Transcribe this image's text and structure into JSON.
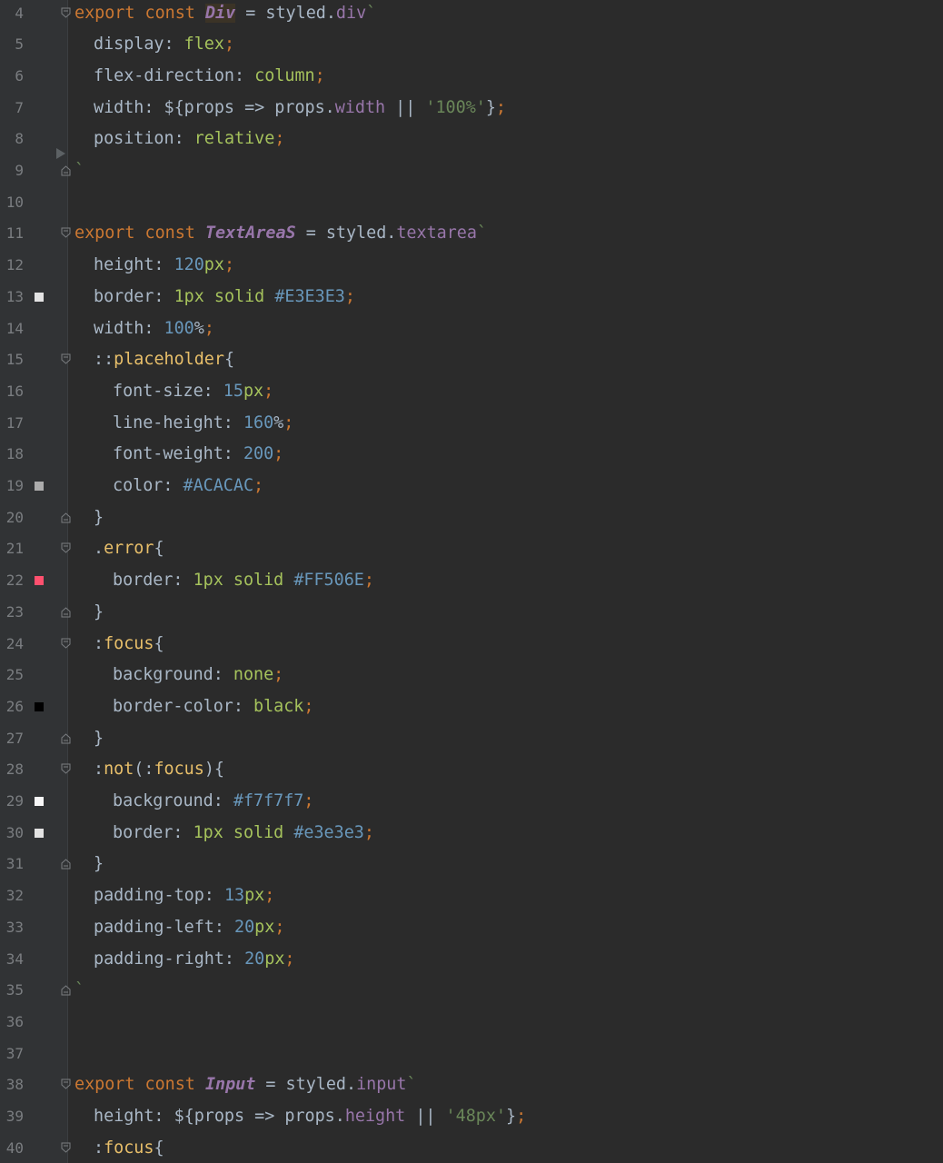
{
  "editor": {
    "language": "javascript",
    "lines": [
      {
        "num": "4",
        "fold": "open",
        "tokens": [
          {
            "t": "export",
            "c": "kw"
          },
          {
            "t": " ",
            "c": "plain"
          },
          {
            "t": "const",
            "c": "kw"
          },
          {
            "t": " ",
            "c": "plain"
          },
          {
            "t": "Div",
            "c": "name",
            "hl": true
          },
          {
            "t": " = styled.",
            "c": "plain"
          },
          {
            "t": "div",
            "c": "tag"
          },
          {
            "t": "`",
            "c": "str"
          }
        ]
      },
      {
        "num": "5",
        "indent": 1,
        "tokens": [
          {
            "t": "display: ",
            "c": "prop"
          },
          {
            "t": "flex",
            "c": "val"
          },
          {
            "t": ";",
            "c": "punct"
          }
        ]
      },
      {
        "num": "6",
        "indent": 1,
        "tokens": [
          {
            "t": "flex-direction: ",
            "c": "prop"
          },
          {
            "t": "column",
            "c": "val"
          },
          {
            "t": ";",
            "c": "punct"
          }
        ]
      },
      {
        "num": "7",
        "indent": 1,
        "tokens": [
          {
            "t": "width: ${props => props.",
            "c": "plain"
          },
          {
            "t": "width",
            "c": "tag"
          },
          {
            "t": " || ",
            "c": "plain"
          },
          {
            "t": "'100%'",
            "c": "str"
          },
          {
            "t": "}",
            "c": "plain"
          },
          {
            "t": ";",
            "c": "punct"
          }
        ]
      },
      {
        "num": "8",
        "indent": 1,
        "tokens": [
          {
            "t": "position: ",
            "c": "prop"
          },
          {
            "t": "relative",
            "c": "val"
          },
          {
            "t": ";",
            "c": "punct"
          }
        ]
      },
      {
        "num": "9",
        "fold": "close",
        "tokens": [
          {
            "t": "`",
            "c": "str"
          }
        ]
      },
      {
        "num": "10",
        "tokens": []
      },
      {
        "num": "11",
        "fold": "open",
        "tokens": [
          {
            "t": "export",
            "c": "kw"
          },
          {
            "t": " ",
            "c": "plain"
          },
          {
            "t": "const",
            "c": "kw"
          },
          {
            "t": " ",
            "c": "plain"
          },
          {
            "t": "TextAreaS",
            "c": "name"
          },
          {
            "t": " = styled.",
            "c": "plain"
          },
          {
            "t": "textarea",
            "c": "tag"
          },
          {
            "t": "`",
            "c": "str"
          }
        ]
      },
      {
        "num": "12",
        "indent": 1,
        "tokens": [
          {
            "t": "height: ",
            "c": "prop"
          },
          {
            "t": "120",
            "c": "num"
          },
          {
            "t": "px",
            "c": "unit"
          },
          {
            "t": ";",
            "c": "punct"
          }
        ]
      },
      {
        "num": "13",
        "indent": 1,
        "swatch": "#E3E3E3",
        "tokens": [
          {
            "t": "border: ",
            "c": "prop"
          },
          {
            "t": "1px",
            "c": "unit"
          },
          {
            "t": " ",
            "c": "plain"
          },
          {
            "t": "solid",
            "c": "val"
          },
          {
            "t": " ",
            "c": "plain"
          },
          {
            "t": "#E3E3E3",
            "c": "hash"
          },
          {
            "t": ";",
            "c": "punct"
          }
        ]
      },
      {
        "num": "14",
        "indent": 1,
        "tokens": [
          {
            "t": "width: ",
            "c": "prop"
          },
          {
            "t": "100",
            "c": "num"
          },
          {
            "t": "%",
            "c": "plain"
          },
          {
            "t": ";",
            "c": "punct"
          }
        ]
      },
      {
        "num": "15",
        "indent": 1,
        "fold": "open",
        "tokens": [
          {
            "t": "::",
            "c": "plain"
          },
          {
            "t": "placeholder",
            "c": "sel"
          },
          {
            "t": "{",
            "c": "plain"
          }
        ]
      },
      {
        "num": "16",
        "indent": 2,
        "tokens": [
          {
            "t": "font-size: ",
            "c": "prop"
          },
          {
            "t": "15",
            "c": "num"
          },
          {
            "t": "px",
            "c": "unit"
          },
          {
            "t": ";",
            "c": "punct"
          }
        ]
      },
      {
        "num": "17",
        "indent": 2,
        "tokens": [
          {
            "t": "line-height: ",
            "c": "prop"
          },
          {
            "t": "160",
            "c": "num"
          },
          {
            "t": "%",
            "c": "plain"
          },
          {
            "t": ";",
            "c": "punct"
          }
        ]
      },
      {
        "num": "18",
        "indent": 2,
        "tokens": [
          {
            "t": "font-weight: ",
            "c": "prop"
          },
          {
            "t": "200",
            "c": "num"
          },
          {
            "t": ";",
            "c": "punct"
          }
        ]
      },
      {
        "num": "19",
        "indent": 2,
        "swatch": "#ACACAC",
        "tokens": [
          {
            "t": "color: ",
            "c": "prop"
          },
          {
            "t": "#ACACAC",
            "c": "hash"
          },
          {
            "t": ";",
            "c": "punct"
          }
        ]
      },
      {
        "num": "20",
        "indent": 1,
        "fold": "close",
        "tokens": [
          {
            "t": "}",
            "c": "plain"
          }
        ]
      },
      {
        "num": "21",
        "indent": 1,
        "fold": "open",
        "tokens": [
          {
            "t": ".",
            "c": "plain"
          },
          {
            "t": "error",
            "c": "sel"
          },
          {
            "t": "{",
            "c": "plain"
          }
        ]
      },
      {
        "num": "22",
        "indent": 2,
        "swatch": "#FF506E",
        "tokens": [
          {
            "t": "border: ",
            "c": "prop"
          },
          {
            "t": "1px",
            "c": "unit"
          },
          {
            "t": " ",
            "c": "plain"
          },
          {
            "t": "solid",
            "c": "val"
          },
          {
            "t": " ",
            "c": "plain"
          },
          {
            "t": "#FF506E",
            "c": "hash"
          },
          {
            "t": ";",
            "c": "punct"
          }
        ]
      },
      {
        "num": "23",
        "indent": 1,
        "fold": "close",
        "tokens": [
          {
            "t": "}",
            "c": "plain"
          }
        ]
      },
      {
        "num": "24",
        "indent": 1,
        "fold": "open",
        "tokens": [
          {
            "t": ":",
            "c": "plain"
          },
          {
            "t": "focus",
            "c": "sel"
          },
          {
            "t": "{",
            "c": "plain"
          }
        ]
      },
      {
        "num": "25",
        "indent": 2,
        "tokens": [
          {
            "t": "background: ",
            "c": "prop"
          },
          {
            "t": "none",
            "c": "val"
          },
          {
            "t": ";",
            "c": "punct"
          }
        ]
      },
      {
        "num": "26",
        "indent": 2,
        "swatch": "#000000",
        "tokens": [
          {
            "t": "border-color: ",
            "c": "prop"
          },
          {
            "t": "black",
            "c": "val"
          },
          {
            "t": ";",
            "c": "punct"
          }
        ]
      },
      {
        "num": "27",
        "indent": 1,
        "fold": "close",
        "tokens": [
          {
            "t": "}",
            "c": "plain"
          }
        ]
      },
      {
        "num": "28",
        "indent": 1,
        "fold": "open",
        "tokens": [
          {
            "t": ":",
            "c": "plain"
          },
          {
            "t": "not",
            "c": "sel"
          },
          {
            "t": "(:",
            "c": "plain"
          },
          {
            "t": "focus",
            "c": "sel"
          },
          {
            "t": "){",
            "c": "plain"
          }
        ]
      },
      {
        "num": "29",
        "indent": 2,
        "swatch": "#F7F7F7",
        "tokens": [
          {
            "t": "background: ",
            "c": "prop"
          },
          {
            "t": "#f7f7f7",
            "c": "hash"
          },
          {
            "t": ";",
            "c": "punct"
          }
        ]
      },
      {
        "num": "30",
        "indent": 2,
        "swatch": "#E3E3E3",
        "tokens": [
          {
            "t": "border: ",
            "c": "prop"
          },
          {
            "t": "1px",
            "c": "unit"
          },
          {
            "t": " ",
            "c": "plain"
          },
          {
            "t": "solid",
            "c": "val"
          },
          {
            "t": " ",
            "c": "plain"
          },
          {
            "t": "#e3e3e3",
            "c": "hash"
          },
          {
            "t": ";",
            "c": "punct"
          }
        ]
      },
      {
        "num": "31",
        "indent": 1,
        "fold": "close",
        "tokens": [
          {
            "t": "}",
            "c": "plain"
          }
        ]
      },
      {
        "num": "32",
        "indent": 1,
        "tokens": [
          {
            "t": "padding-top: ",
            "c": "prop"
          },
          {
            "t": "13",
            "c": "num"
          },
          {
            "t": "px",
            "c": "unit"
          },
          {
            "t": ";",
            "c": "punct"
          }
        ]
      },
      {
        "num": "33",
        "indent": 1,
        "tokens": [
          {
            "t": "padding-left: ",
            "c": "prop"
          },
          {
            "t": "20",
            "c": "num"
          },
          {
            "t": "px",
            "c": "unit"
          },
          {
            "t": ";",
            "c": "punct"
          }
        ]
      },
      {
        "num": "34",
        "indent": 1,
        "tokens": [
          {
            "t": "padding-right: ",
            "c": "prop"
          },
          {
            "t": "20",
            "c": "num"
          },
          {
            "t": "px",
            "c": "unit"
          },
          {
            "t": ";",
            "c": "punct"
          }
        ]
      },
      {
        "num": "35",
        "fold": "close",
        "tokens": [
          {
            "t": "`",
            "c": "str"
          }
        ]
      },
      {
        "num": "36",
        "tokens": []
      },
      {
        "num": "37",
        "tokens": []
      },
      {
        "num": "38",
        "fold": "open",
        "tokens": [
          {
            "t": "export",
            "c": "kw"
          },
          {
            "t": " ",
            "c": "plain"
          },
          {
            "t": "const",
            "c": "kw"
          },
          {
            "t": " ",
            "c": "plain"
          },
          {
            "t": "Input",
            "c": "name"
          },
          {
            "t": " = styled.",
            "c": "plain"
          },
          {
            "t": "input",
            "c": "tag"
          },
          {
            "t": "`",
            "c": "str"
          }
        ]
      },
      {
        "num": "39",
        "indent": 1,
        "tokens": [
          {
            "t": "height: ${props => props.",
            "c": "plain"
          },
          {
            "t": "height",
            "c": "tag"
          },
          {
            "t": " || ",
            "c": "plain"
          },
          {
            "t": "'48px'",
            "c": "str"
          },
          {
            "t": "}",
            "c": "plain"
          },
          {
            "t": ";",
            "c": "punct"
          }
        ]
      },
      {
        "num": "40",
        "indent": 1,
        "fold": "open",
        "tokens": [
          {
            "t": ":",
            "c": "plain"
          },
          {
            "t": "focus",
            "c": "sel"
          },
          {
            "t": "{",
            "c": "plain"
          }
        ]
      }
    ]
  }
}
